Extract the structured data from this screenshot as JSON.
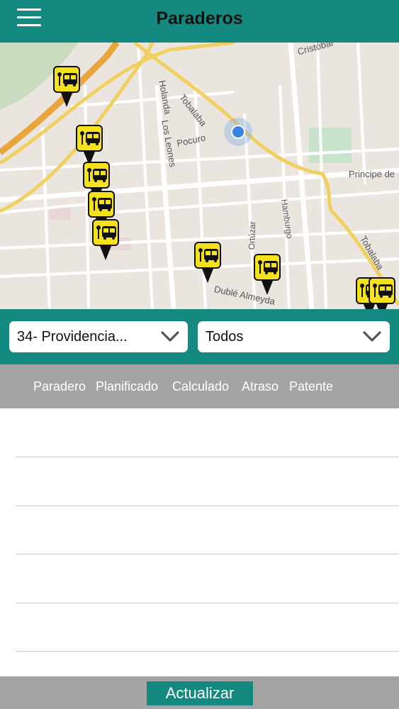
{
  "header": {
    "title": "Paraderos",
    "menu_icon": "hamburger-menu-icon"
  },
  "colors": {
    "brand": "#14897f",
    "header_bar": "#a4a4a4",
    "stop_marker": "#f5e11e",
    "location": "#3b82e6"
  },
  "map": {
    "street_labels": {
      "tobalaba_top": "Tobalaba",
      "holanda": "Holanda",
      "los_leones": "Los Leones",
      "pocuro": "Pocuro",
      "cristobal": "Cristóbal",
      "principe_de": "Principe de",
      "ortuzar": "Ortúzar",
      "hamburgo": "Hamburgo",
      "tobalaba_bottom": "Tobalaba",
      "duble_almeyda": "Dublé Almeyda"
    },
    "stop_icon": "bus-stop-icon",
    "location_icon": "current-location-icon"
  },
  "filters": {
    "route": {
      "value": "34- Providencia..."
    },
    "direction": {
      "value": "Todos"
    }
  },
  "table": {
    "columns": [
      "Paradero",
      "Planificado",
      "Calculado",
      "Atraso",
      "Patente"
    ],
    "rows": []
  },
  "footer": {
    "refresh_label": "Actualizar"
  }
}
